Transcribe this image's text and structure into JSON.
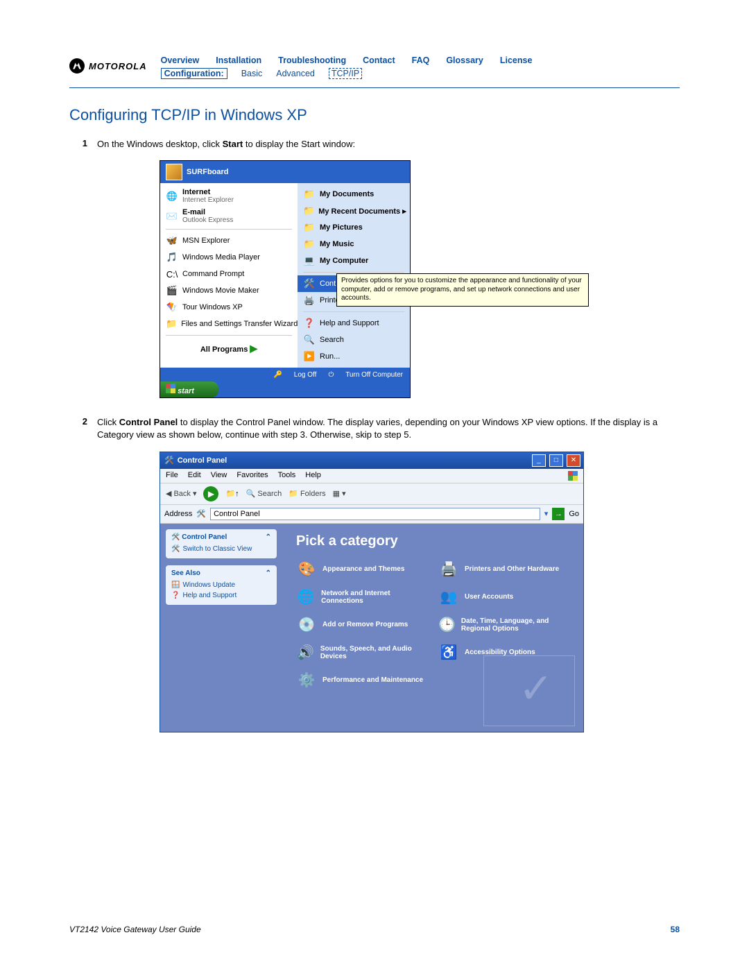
{
  "brand": {
    "name": "MOTOROLA"
  },
  "nav": {
    "top": [
      "Overview",
      "Installation",
      "Troubleshooting",
      "Contact",
      "FAQ",
      "Glossary",
      "License"
    ],
    "config_label": "Configuration:",
    "sub": [
      "Basic",
      "Advanced",
      "TCP/IP"
    ]
  },
  "section_title": "Configuring TCP/IP in Windows XP",
  "steps": {
    "s1": {
      "num": "1",
      "pre": "On the Windows desktop, click ",
      "bold": "Start",
      "post": " to display the Start window:"
    },
    "s2": {
      "num": "2",
      "pre": "Click ",
      "bold": "Control Panel",
      "post": " to display the Control Panel window. The display varies, depending on your Windows XP view options. If the display is a Category view as shown below, continue with step 3. Otherwise, skip to step 5."
    }
  },
  "start_menu": {
    "user": "SURFboard",
    "left": [
      {
        "icon": "🌐",
        "title": "Internet",
        "sub": "Internet Explorer",
        "bold": true
      },
      {
        "icon": "✉️",
        "title": "E-mail",
        "sub": "Outlook Express",
        "bold": true
      },
      {
        "icon": "🦋",
        "title": "MSN Explorer"
      },
      {
        "icon": "🎵",
        "title": "Windows Media Player"
      },
      {
        "icon": "C:\\",
        "title": "Command Prompt"
      },
      {
        "icon": "🎬",
        "title": "Windows Movie Maker"
      },
      {
        "icon": "🪁",
        "title": "Tour Windows XP"
      },
      {
        "icon": "📁",
        "title": "Files and Settings Transfer Wizard"
      }
    ],
    "all_programs": "All Programs",
    "right": [
      {
        "icon": "📁",
        "title": "My Documents",
        "bold": true
      },
      {
        "icon": "📁",
        "title": "My Recent Documents",
        "bold": true,
        "arrow": true
      },
      {
        "icon": "📁",
        "title": "My Pictures",
        "bold": true
      },
      {
        "icon": "📁",
        "title": "My Music",
        "bold": true
      },
      {
        "icon": "💻",
        "title": "My Computer",
        "bold": true
      },
      {
        "icon": "🛠️",
        "title": "Control Panel",
        "selected": true
      },
      {
        "icon": "🖨️",
        "title": "Printers a"
      },
      {
        "icon": "❓",
        "title": "Help and Support"
      },
      {
        "icon": "🔍",
        "title": "Search"
      },
      {
        "icon": "▶️",
        "title": "Run..."
      }
    ],
    "tooltip": "Provides options for you to customize the appearance and functionality of your computer, add or remove programs, and set up network connections and user accounts.",
    "footer": {
      "logoff": "Log Off",
      "turnoff": "Turn Off Computer"
    },
    "start_button": "start"
  },
  "control_panel": {
    "title": "Control Panel",
    "menus": [
      "File",
      "Edit",
      "View",
      "Favorites",
      "Tools",
      "Help"
    ],
    "toolbar": {
      "back": "Back",
      "search": "Search",
      "folders": "Folders"
    },
    "address_label": "Address",
    "address_value": "Control Panel",
    "go": "Go",
    "side": {
      "panel1": {
        "title": "Control Panel",
        "link": "Switch to Classic View"
      },
      "panel2": {
        "title": "See Also",
        "links": [
          "Windows Update",
          "Help and Support"
        ]
      }
    },
    "main_title": "Pick a category",
    "categories": [
      {
        "icon": "🎨",
        "label": "Appearance and Themes"
      },
      {
        "icon": "🖨️",
        "label": "Printers and Other Hardware"
      },
      {
        "icon": "🌐",
        "label": "Network and Internet Connections"
      },
      {
        "icon": "👥",
        "label": "User Accounts"
      },
      {
        "icon": "💿",
        "label": "Add or Remove Programs"
      },
      {
        "icon": "🕒",
        "label": "Date, Time, Language, and Regional Options"
      },
      {
        "icon": "🔊",
        "label": "Sounds, Speech, and Audio Devices"
      },
      {
        "icon": "♿",
        "label": "Accessibility Options"
      },
      {
        "icon": "⚙️",
        "label": "Performance and Maintenance"
      }
    ]
  },
  "footer": {
    "guide": "VT2142 Voice Gateway User Guide",
    "page": "58"
  }
}
